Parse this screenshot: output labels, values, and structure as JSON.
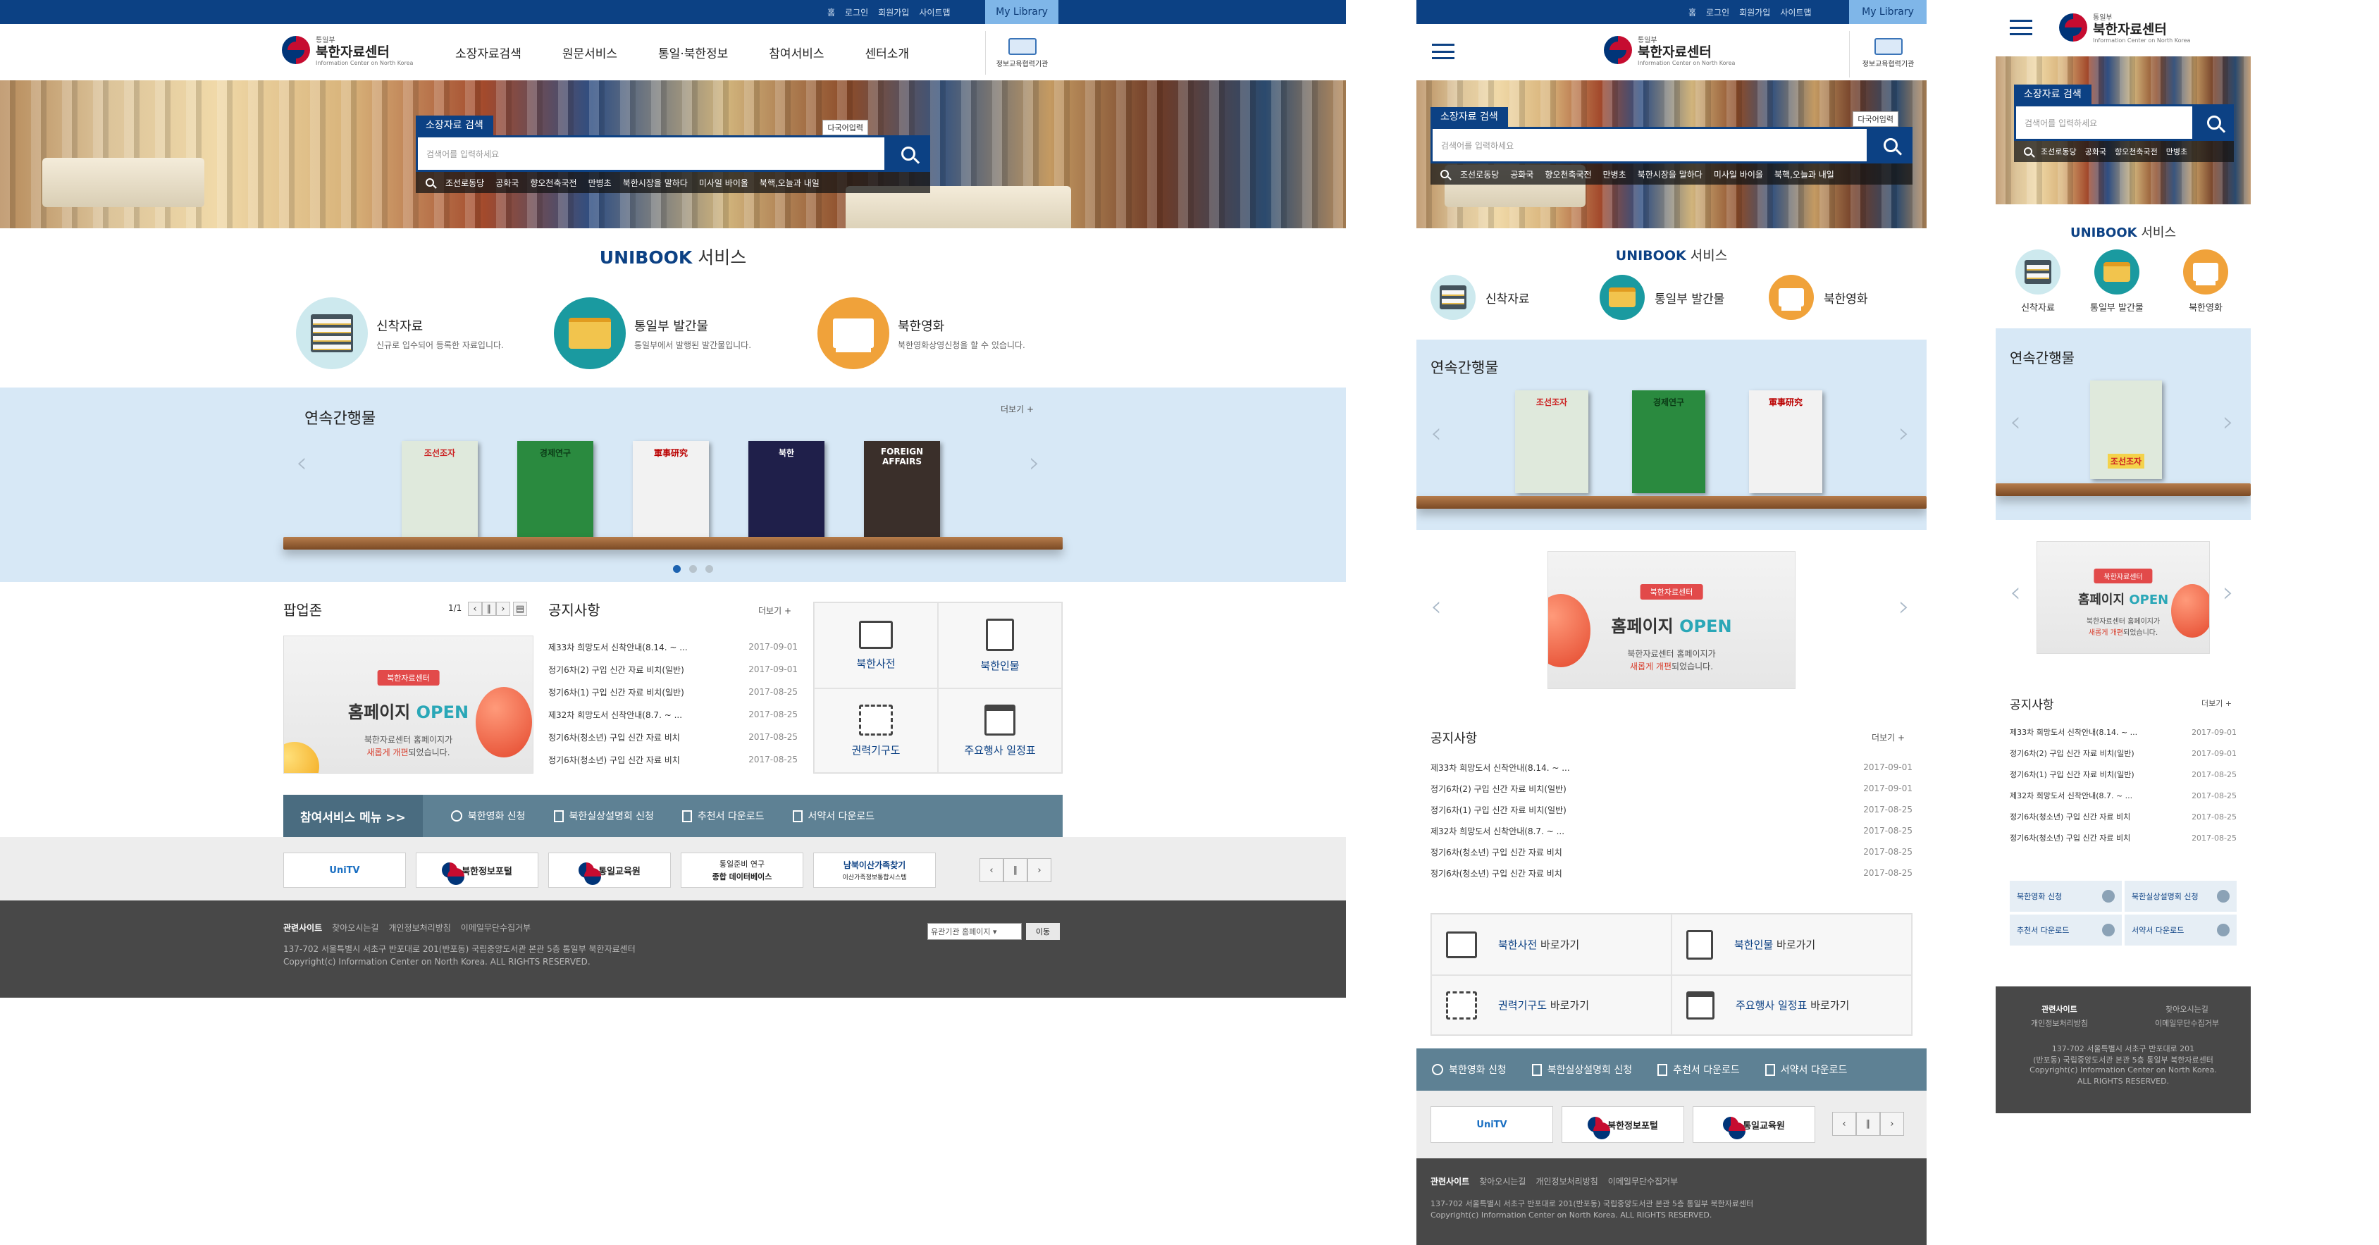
{
  "site": {
    "ministry": "통일부",
    "name": "북한자료센터",
    "name_en": "Information Center on North Korea"
  },
  "util": {
    "links": [
      "홈",
      "로그인",
      "회원가입",
      "사이트맵"
    ],
    "my_library": "My Library"
  },
  "gnb": [
    "소장자료검색",
    "원문서비스",
    "통일·북한정보",
    "참여서비스",
    "센터소개"
  ],
  "cert": "정보교육협력기관",
  "search": {
    "tag": "소장자료 검색",
    "multi": "다국어입력",
    "placeholder": "검색어를 입력하세요",
    "keywords": [
      "조선로동당",
      "공화국",
      "향오천축국전",
      "만병초",
      "북한시장을 말하다",
      "미사일 바이올",
      "북핵,오늘과 내일"
    ]
  },
  "unibook": {
    "brand": "UNIBOOK",
    "label": "서비스",
    "items": [
      {
        "name": "신착자료",
        "desc": "신규로 입수되어 등록한 자료입니다."
      },
      {
        "name": "통일부 발간물",
        "desc": "통일부에서 발행된 발간물입니다."
      },
      {
        "name": "북한영화",
        "desc": "북한영화상영신청을 할 수 있습니다."
      }
    ]
  },
  "serial": {
    "title": "연속간행물",
    "more": "더보기",
    "mags": [
      {
        "title": "조선조자",
        "color": "#dfe9dc",
        "text": "#c22"
      },
      {
        "title": "경제연구",
        "color": "#2a8a3f",
        "text": "#0b3b16"
      },
      {
        "title": "軍事研究",
        "color": "#f2f2f2",
        "text": "#b00"
      },
      {
        "title": "북한",
        "color": "#1f1f4a",
        "text": "#fff"
      },
      {
        "title": "FOREIGN AFFAIRS",
        "color": "#3a2f2a",
        "text": "#fff"
      }
    ]
  },
  "popup": {
    "title": "팝업존",
    "page": "1/1"
  },
  "banner": {
    "ribbon": "북한자료센터",
    "big_a": "홈페이지 ",
    "big_b": "OPEN",
    "line1": "북한자료센터 홈페이지가",
    "line2_red": "새롭게 개편",
    "line2_tail": "되었습니다."
  },
  "notice": {
    "title": "공지사항",
    "more": "더보기",
    "items": [
      {
        "t": "제33차 희망도서 신착안내(8.14. ~ ...",
        "d": "2017-09-01"
      },
      {
        "t": "정기6차(2) 구입 신간 자료 비치(일반)",
        "d": "2017-09-01"
      },
      {
        "t": "정기6차(1) 구입 신간 자료 비치(일반)",
        "d": "2017-08-25"
      },
      {
        "t": "제32차 희망도서 신착안내(8.7. ~ ...",
        "d": "2017-08-25"
      },
      {
        "t": "정기6차(청소년) 구입 신간 자료 비치",
        "d": "2017-08-25"
      },
      {
        "t": "정기6차(청소년) 구입 신간 자료 비치",
        "d": "2017-08-25"
      }
    ]
  },
  "notice_m": {
    "items": [
      {
        "t": "제33차 희망도서 신착안내(8.14. ~ ...",
        "d": "2017-09-01"
      },
      {
        "t": "정기6차(2) 구입 신간 자료 비치(일반)",
        "d": "2017-09-01"
      },
      {
        "t": "정기6차(1) 구입 신간 자료 비치(일반)",
        "d": "2017-08-25"
      },
      {
        "t": "제32차 희망도서 신착안내(8.7. ~ ...",
        "d": "2017-08-25"
      },
      {
        "t": "정기6차(청소년) 구입 신간 자료 비치",
        "d": "2017-08-25"
      },
      {
        "t": "정기6차(청소년) 구입 신간 자료 비치",
        "d": "2017-08-25"
      }
    ]
  },
  "quick": [
    "북한사전",
    "북한인물",
    "권력기구도",
    "주요행사 일정표"
  ],
  "quick_suffix": "바로가기",
  "participate": {
    "title": "참여서비스 메뉴 >>",
    "items": [
      "북한영화 신청",
      "북한실상설명회 신청",
      "추천서 다운로드",
      "서약서 다운로드"
    ]
  },
  "family": [
    "UniTV",
    "북한정보포털",
    "통일교육원",
    "통일준비 연구 종합 데이터베이스",
    "남북이산가족찾기"
  ],
  "family_sub": {
    "b1": "통일부",
    "b4a": "통일준비 연구",
    "b4b": "종합 데이터베이스",
    "b5a": "남북이산가족찾기",
    "b5b": "이산가족정보통합시스템",
    "b2sub": "북한(통)"
  },
  "footer": {
    "links": [
      "관련사이트",
      "찾아오시는길",
      "개인정보처리방침",
      "이메일무단수집거부"
    ],
    "addr": "137-702 서울특별시 서초구 반포대로 201(반포동) 국립중앙도서관 본관 5층 통일부 북한자료센터",
    "copy": "Copyright(c) Information Center on North Korea. ALL RIGHTS RESERVED.",
    "select": "유관기관 홈페이지",
    "go": "이동",
    "m_addr1": "137-702 서울특별시 서초구 반포대로 201",
    "m_addr2": "(반포동) 국립중앙도서관 본관 5층 통일부 북한자료센터",
    "m_copy1": "Copyright(c) Information Center on North Korea.",
    "m_copy2": "ALL RIGHTS RESERVED."
  },
  "colors": {
    "brand": "#0c4184",
    "accent": "#7fb6e8",
    "serial_bg": "#d7e8f6",
    "bar": "#5e8194",
    "footer": "#484848"
  }
}
